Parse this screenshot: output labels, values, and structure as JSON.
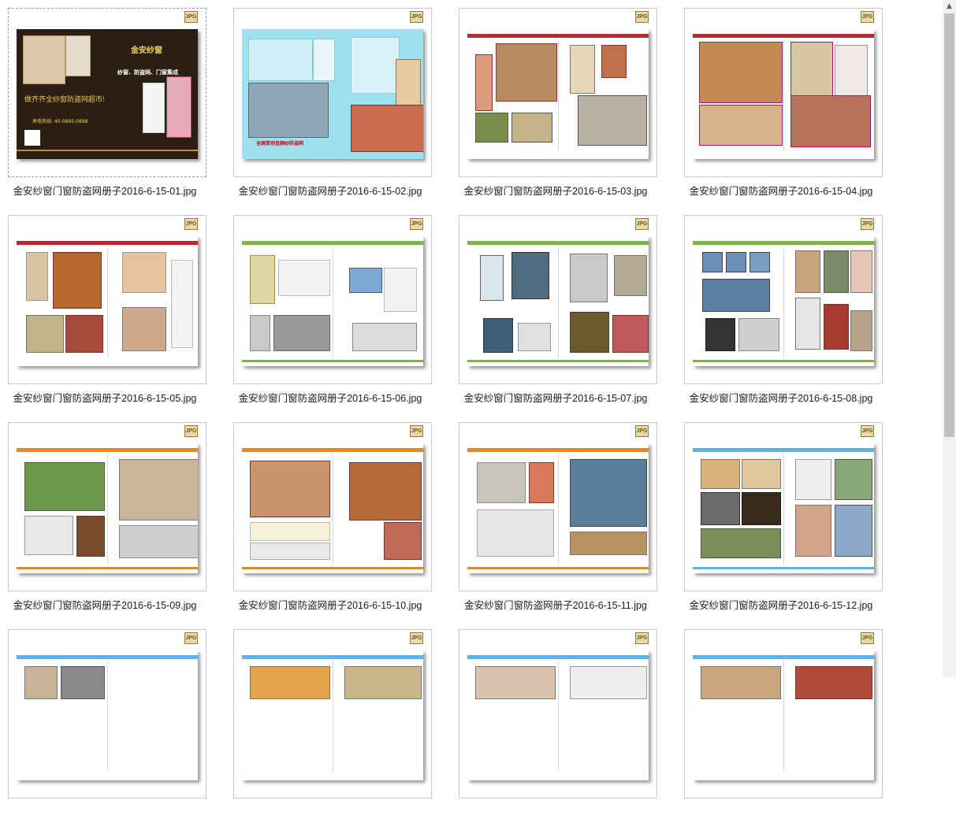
{
  "badge_label": "JPG",
  "files": [
    {
      "name": "金安纱窗门窗防盗网册子2016-6-15-01.jpg"
    },
    {
      "name": "金安纱窗门窗防盗网册子2016-6-15-02.jpg"
    },
    {
      "name": "金安纱窗门窗防盗网册子2016-6-15-03.jpg"
    },
    {
      "name": "金安纱窗门窗防盗网册子2016-6-15-04.jpg"
    },
    {
      "name": "金安纱窗门窗防盗网册子2016-6-15-05.jpg"
    },
    {
      "name": "金安纱窗门窗防盗网册子2016-6-15-06.jpg"
    },
    {
      "name": "金安纱窗门窗防盗网册子2016-6-15-07.jpg"
    },
    {
      "name": "金安纱窗门窗防盗网册子2016-6-15-08.jpg"
    },
    {
      "name": "金安纱窗门窗防盗网册子2016-6-15-09.jpg"
    },
    {
      "name": "金安纱窗门窗防盗网册子2016-6-15-10.jpg"
    },
    {
      "name": "金安纱窗门窗防盗网册子2016-6-15-11.jpg"
    },
    {
      "name": "金安纱窗门窗防盗网册子2016-6-15-12.jpg"
    },
    {
      "name": ""
    },
    {
      "name": ""
    },
    {
      "name": ""
    },
    {
      "name": ""
    }
  ],
  "cover": {
    "brand": "金安纱窗",
    "slogan": "纱窗、防盗网、门窗集成",
    "headline": "做齐齐全纱窗防盗网超市!",
    "hotline": "来电热线: 40-0895-0898"
  },
  "page2": {
    "title_left": "全国首创金刚纱防盗网"
  },
  "colors": {
    "accent_red": "#c0272d",
    "accent_green": "#7ab648",
    "accent_orange": "#e58a1f",
    "accent_blue": "#5bb4e5"
  },
  "scrollbar": {
    "up_icon": "▲"
  }
}
